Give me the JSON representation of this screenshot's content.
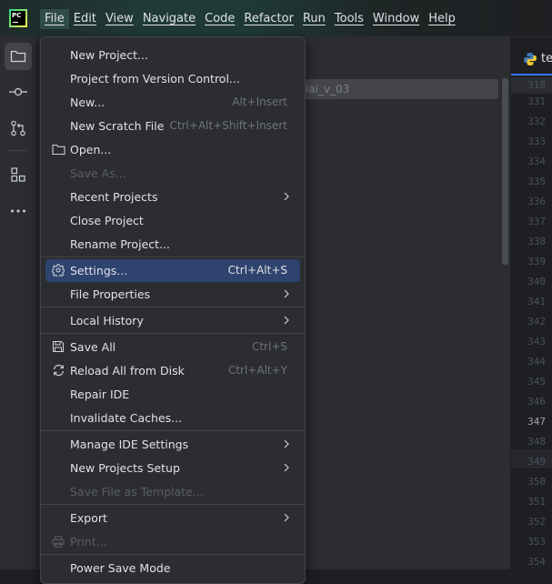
{
  "app": {
    "logo_text": "PC"
  },
  "menubar": [
    {
      "label": "File",
      "active": true
    },
    {
      "label": "Edit"
    },
    {
      "label": "View"
    },
    {
      "label": "Navigate"
    },
    {
      "label": "Code"
    },
    {
      "label": "Refactor"
    },
    {
      "label": "Run"
    },
    {
      "label": "Tools"
    },
    {
      "label": "Window"
    },
    {
      "label": "Help"
    }
  ],
  "project_panel": {
    "selected_row_text": "lai_v_03"
  },
  "editor": {
    "tab_name": "tes",
    "line_numbers": [
      "318",
      "331",
      "332",
      "333",
      "334",
      "335",
      "336",
      "337",
      "338",
      "339",
      "340",
      "341",
      "342",
      "343",
      "344",
      "345",
      "346",
      "347",
      "348",
      "349",
      "350",
      "351",
      "352",
      "353",
      "354"
    ],
    "current_line": "347"
  },
  "file_menu": {
    "items": [
      {
        "label": "New Project..."
      },
      {
        "label": "Project from Version Control..."
      },
      {
        "label": "New...",
        "shortcut": "Alt+Insert"
      },
      {
        "label": "New Scratch File",
        "shortcut": "Ctrl+Alt+Shift+Insert"
      },
      {
        "label": "Open...",
        "icon": "folder-icon"
      },
      {
        "label": "Save As...",
        "disabled": true
      },
      {
        "label": "Recent Projects",
        "submenu": true
      },
      {
        "label": "Close Project"
      },
      {
        "label": "Rename Project..."
      },
      {
        "label": "Settings...",
        "shortcut": "Ctrl+Alt+S",
        "icon": "gear-icon",
        "highlighted": true
      },
      {
        "label": "File Properties",
        "submenu": true
      },
      {
        "label": "Local History",
        "submenu": true
      },
      {
        "label": "Save All",
        "shortcut": "Ctrl+S",
        "icon": "save-icon"
      },
      {
        "label": "Reload All from Disk",
        "shortcut": "Ctrl+Alt+Y",
        "icon": "reload-icon"
      },
      {
        "label": "Repair IDE"
      },
      {
        "label": "Invalidate Caches..."
      },
      {
        "label": "Manage IDE Settings",
        "submenu": true
      },
      {
        "label": "New Projects Setup",
        "submenu": true
      },
      {
        "label": "Save File as Template...",
        "disabled": true
      },
      {
        "label": "Export",
        "submenu": true
      },
      {
        "label": "Print...",
        "disabled": true,
        "icon": "print-icon"
      },
      {
        "label": "Power Save Mode"
      }
    ]
  },
  "colors": {
    "highlight": "#2e436e",
    "accent": "#3574f0",
    "menu_bg": "#2b2d30",
    "text": "#dfe1e5",
    "shortcut": "#6f737a",
    "disabled": "#5a5d63"
  }
}
